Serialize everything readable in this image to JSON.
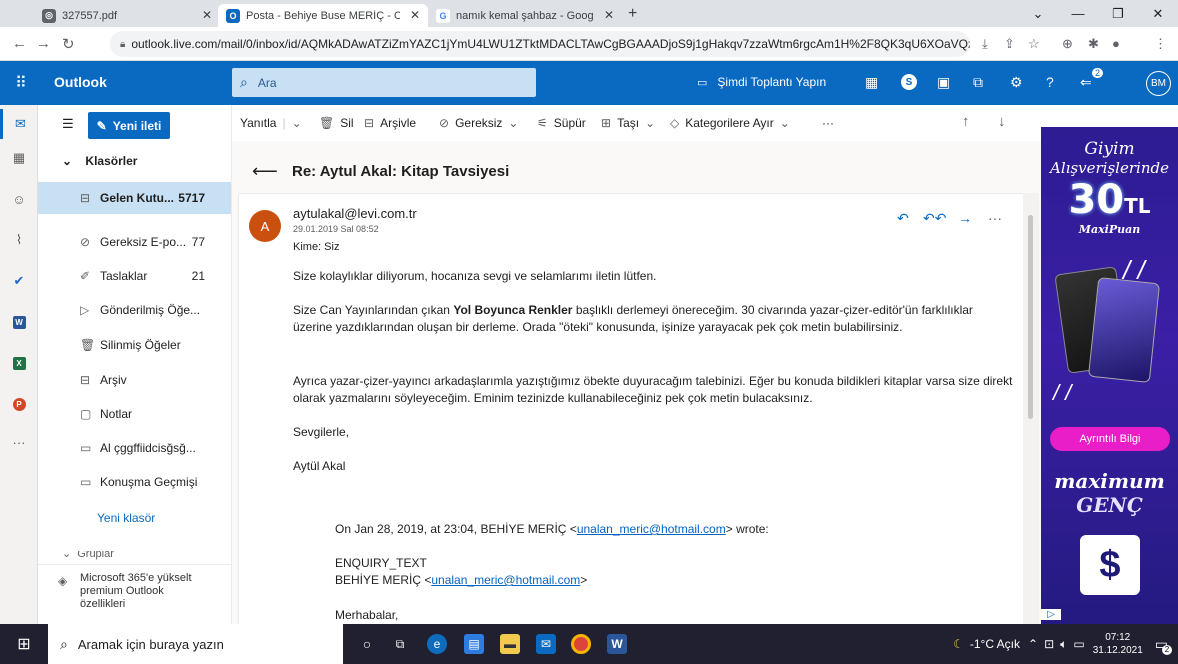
{
  "browser": {
    "tabs": [
      {
        "label": "327557.pdf",
        "icon": "globe-icon"
      },
      {
        "label": "Posta - Behiye Buse MERİÇ - Out",
        "icon": "outlook-icon",
        "active": true
      },
      {
        "label": "namık kemal şahbaz - Google'da",
        "icon": "google-icon"
      }
    ],
    "new_tab": "+",
    "url": "outlook.live.com/mail/0/inbox/id/AQMkADAwATZiZmYAZC1jYmU4LWU1ZTktMDACLTAwCgBGAAADjoS9j1gHakqv7zzaWtm6rgcAm1H%2F8QK3qU6XOaVQzX..."
  },
  "header": {
    "brand": "Outlook",
    "search_placeholder": "Ara",
    "meet_now": "Şimdi Toplantı Yapın",
    "notif_count": "2",
    "avatar": "BM"
  },
  "folder_pane": {
    "new_message": "Yeni ileti",
    "folders_title": "Klasörler",
    "folders": [
      {
        "name": "Gelen Kutu...",
        "count": "5717",
        "icon": "inbox-icon",
        "selected": true
      },
      {
        "name": "Gereksiz E-po...",
        "count": "77",
        "icon": "junk-icon"
      },
      {
        "name": "Taslaklar",
        "count": "21",
        "icon": "pencil-icon"
      },
      {
        "name": "Gönderilmiş Öğe...",
        "count": "",
        "icon": "send-icon"
      },
      {
        "name": "Silinmiş Öğeler",
        "count": "",
        "icon": "trash-icon"
      },
      {
        "name": "Arşiv",
        "count": "",
        "icon": "archive-icon"
      },
      {
        "name": "Notlar",
        "count": "",
        "icon": "note-icon"
      },
      {
        "name": "Al çggffiidcisğsğ...",
        "count": "",
        "icon": "folder-icon"
      },
      {
        "name": "Konuşma Geçmişi",
        "count": "",
        "icon": "folder-icon"
      }
    ],
    "new_folder": "Yeni klasör",
    "groups_partial": "Gruplar",
    "upsell": "Microsoft 365'e yükselt premium Outlook özellikleri"
  },
  "commands": {
    "reply": "Yanıtla",
    "delete": "Sil",
    "archive": "Arşivle",
    "junk": "Gereksiz",
    "sweep": "Süpür",
    "move": "Taşı",
    "categorize": "Kategorilere Ayır",
    "more": "···"
  },
  "message": {
    "subject": "Re: Aytul Akal: Kitap Tavsiyesi",
    "avatar_letter": "A",
    "sender": "aytulakal@levi.com.tr",
    "date": "29.01.2019 Sal 08:52",
    "to": "Kime: Siz",
    "p1": "Size kolaylıklar diliyorum, hocanıza sevgi ve selamlarımı iletin lütfen.",
    "p2_a": "Size Can Yayınlarından çıkan ",
    "p2_bold": "Yol Boyunca Renkler",
    "p2_b": " başlıklı derlemeyi önereceğim. 30 civarında yazar-çizer-editör'ün farklılıklar üzerine yazdıklarından oluşan bir derleme. Orada \"öteki\" konusunda, işinize yarayacak pek çok metin bulabilirsiniz.",
    "p3": "Ayrıca yazar-çizer-yayıncı arkadaşlarımla yazıştığımız öbekte duyuracağım talebinizi. Eğer bu konuda bildikleri kitaplar varsa size direkt olarak yazmalarını söyleyeceğim. Eminim tezinizde kullanabileceğiniz pek çok metin bulacaksınız.",
    "closing": "Sevgilerle,",
    "signature": "Aytül Akal",
    "quote_pre": "On Jan 28, 2019, at 23:04, BEHİYE MERİÇ <",
    "quote_email": "unalan_meric@hotmail.com",
    "quote_post": "> wrote:",
    "enquiry": "ENQUIRY_TEXT",
    "q_name": "BEHİYE MERİÇ <",
    "q_email": "unalan_meric@hotmail.com",
    "q_close": ">",
    "greeting": "Merhabalar,"
  },
  "ad": {
    "line1": "Giyim",
    "line2": "Alışverişlerinde",
    "amount": "30",
    "currency": "TL",
    "sub": "MaxiPuan",
    "button": "Ayrıntılı Bilgi",
    "brand1": "maximum",
    "brand2": "GENÇ",
    "logo": "$"
  },
  "taskbar": {
    "search": "Aramak için buraya yazın",
    "weather": "-1°C Açık",
    "time": "07:12",
    "date": "31.12.2021",
    "notif": "2"
  }
}
